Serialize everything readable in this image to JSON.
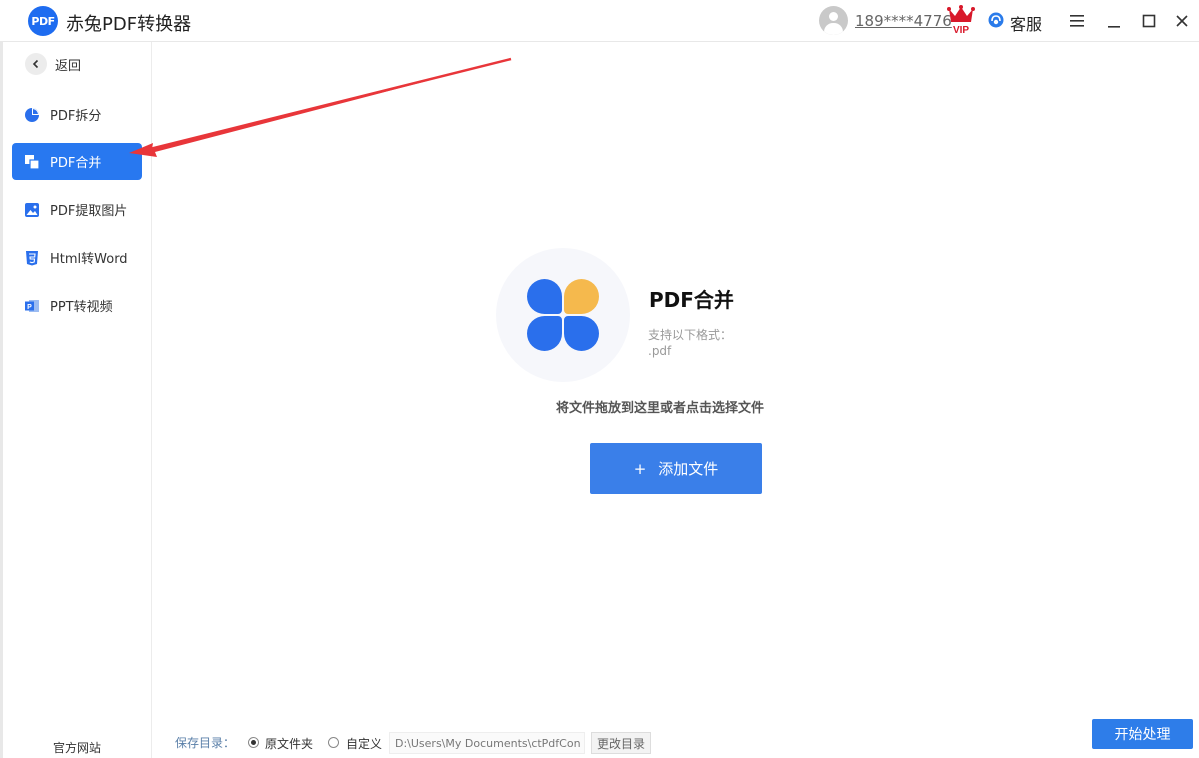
{
  "app": {
    "title": "赤兔PDF转换器",
    "logo_text": "PDF"
  },
  "header": {
    "user_phone": "189****4776",
    "vip_badge": "VIP",
    "customer_service": "客服",
    "icons": [
      "user-avatar-icon",
      "vip-crown-icon",
      "headset-icon",
      "menu-icon",
      "minimize-icon",
      "maximize-icon",
      "close-icon"
    ]
  },
  "sidebar": {
    "back_label": "返回",
    "items": [
      {
        "label": "PDF拆分",
        "icon": "pie-icon",
        "active": false
      },
      {
        "label": "PDF合并",
        "icon": "merge-icon",
        "active": true
      },
      {
        "label": "PDF提取图片",
        "icon": "image-icon",
        "active": false
      },
      {
        "label": "Html转Word",
        "icon": "html5-icon",
        "active": false
      },
      {
        "label": "PPT转视频",
        "icon": "ppt-icon",
        "active": false
      }
    ],
    "official_site": "官方网站"
  },
  "main": {
    "feature_title": "PDF合并",
    "formats_label": "支持以下格式：",
    "formats_value": ".pdf",
    "drop_hint": "将文件拖放到这里或者点击选择文件",
    "add_button": {
      "plus": "+",
      "label": "添加文件"
    }
  },
  "footer": {
    "save_label": "保存目录：",
    "option_original": "原文件夹",
    "option_custom": "自定义",
    "selected": "原文件夹",
    "path": "D:\\Users\\My Documents\\ctPdfCon",
    "change_dir": "更改目录",
    "start_button": "开始处理"
  },
  "colors": {
    "accent": "#2878f0",
    "button": "#3a7fe9",
    "annotation_arrow": "#e8363a",
    "petal_blue": "#2a6fec",
    "petal_yellow": "#f5b94d"
  }
}
